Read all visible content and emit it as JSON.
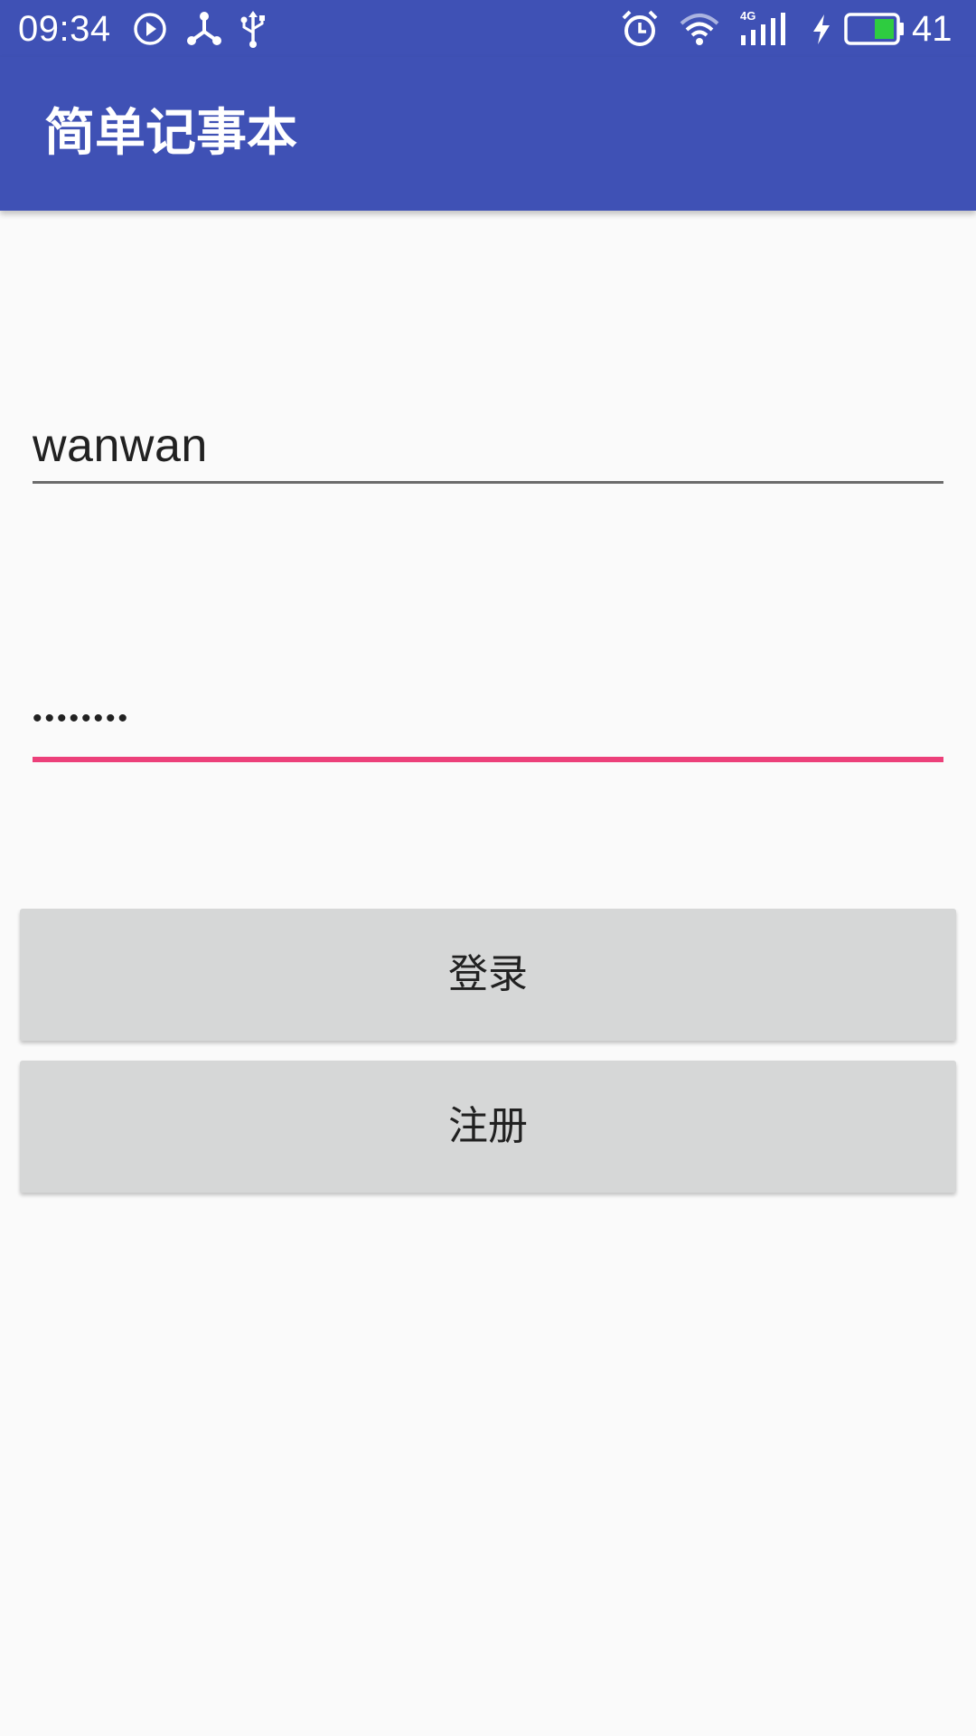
{
  "status_bar": {
    "time": "09:34",
    "battery_level": "41",
    "icons": [
      "play-circle-icon",
      "share-icon",
      "usb-icon",
      "alarm-icon",
      "wifi-icon",
      "signal-4g-icon",
      "charging-bolt-icon",
      "battery-icon"
    ]
  },
  "app_bar": {
    "title": "简单记事本"
  },
  "form": {
    "username_value": "wanwan",
    "password_value": "••••••••",
    "login_label": "登录",
    "register_label": "注册"
  },
  "colors": {
    "primary": "#3f51b5",
    "accent": "#ec407a",
    "background": "#fafafa",
    "button": "#d6d7d7",
    "battery_fill": "#2ecc40"
  }
}
